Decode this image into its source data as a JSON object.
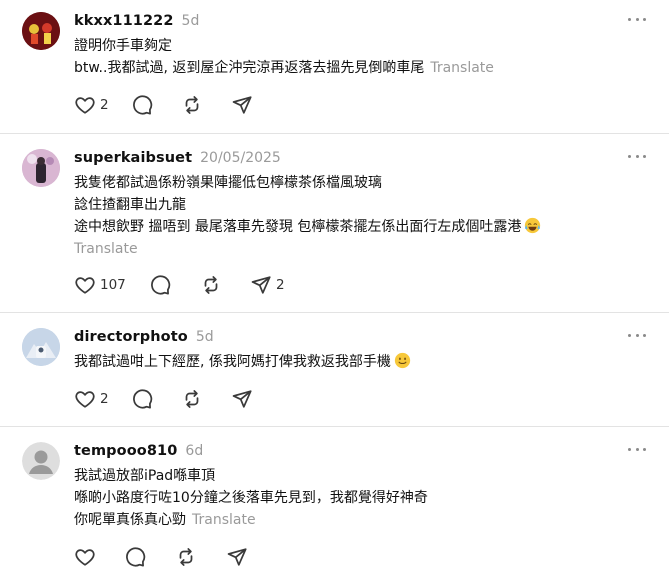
{
  "posts": [
    {
      "username": "kkxx111222",
      "time": "5d",
      "lines": [
        "證明你手車夠定",
        "btw..我都試過, 返到屋企沖完涼再返落去搵先見倒啲車尾"
      ],
      "translate": "Translate",
      "likes": "2",
      "reposts": "",
      "shares": ""
    },
    {
      "username": "superkaibsuet",
      "time": "20/05/2025",
      "lines": [
        "我隻佬都試過係粉嶺果陣擺低包檸檬茶係檔風玻璃",
        "諗住揸翻車出九龍",
        "途中想飲野 搵唔到 最尾落車先發現 包檸檬茶擺左係出面行左成個吐露港"
      ],
      "translate": "Translate",
      "likes": "107",
      "reposts": "",
      "shares": "2"
    },
    {
      "username": "directorphoto",
      "time": "5d",
      "lines": [
        "我都試過咁上下經歷, 係我阿媽打俾我救返我部手機"
      ],
      "likes": "2",
      "reposts": "",
      "shares": ""
    },
    {
      "username": "tempooo810",
      "time": "6d",
      "lines": [
        "我試過放部iPad喺車頂",
        "喺啲小路度行咗10分鐘之後落車先見到，我都覺得好神奇",
        "你呢單真係真心勁"
      ],
      "translate": "Translate",
      "likes": "",
      "reposts": "",
      "shares": ""
    }
  ],
  "icons": {
    "like": "heart-icon",
    "comment": "comment-bubble-icon",
    "repost": "repost-icon",
    "share": "send-icon",
    "more": "more-dots-icon",
    "emoji_laugh": "tears-of-joy-emoji",
    "emoji_smile": "smiling-face-emoji"
  },
  "colors": {
    "text": "#111111",
    "muted": "#9a9a9a",
    "divider": "#e3e3e3",
    "icon": "#3a3a3a"
  }
}
